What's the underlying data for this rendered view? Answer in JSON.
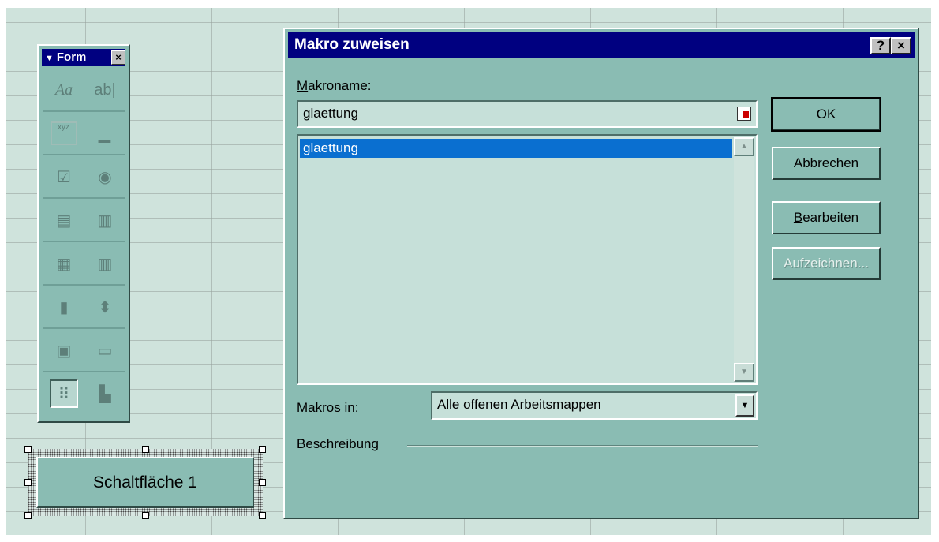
{
  "toolbar": {
    "title": "Form",
    "close": "×",
    "rows": [
      {
        "left_icon": "label-icon",
        "left_glyph": "Aa",
        "right_icon": "edit-box-icon",
        "right_glyph": "ab|"
      },
      {
        "left_icon": "group-box-icon",
        "left_glyph": "xyz",
        "right_icon": "button-icon",
        "right_glyph": "▁"
      },
      {
        "left_icon": "checkbox-icon",
        "left_glyph": "☑",
        "right_icon": "option-button-icon",
        "right_glyph": "◉"
      },
      {
        "left_icon": "list-box-icon",
        "left_glyph": "▤",
        "right_icon": "combo-box-icon",
        "right_glyph": "▥"
      },
      {
        "left_icon": "combo-list-edit-icon",
        "left_glyph": "▦",
        "right_icon": "combo-dropdown-edit-icon",
        "right_glyph": "▥"
      },
      {
        "left_icon": "scroll-bar-icon",
        "left_glyph": "▮",
        "right_icon": "spinner-icon",
        "right_glyph": "⬍"
      },
      {
        "left_icon": "control-properties-icon",
        "left_glyph": "▣",
        "right_icon": "edit-code-icon",
        "right_glyph": "▭"
      },
      {
        "left_icon": "toggle-grid-icon",
        "left_glyph": "⠿",
        "right_icon": "run-dialog-icon",
        "right_glyph": "▙"
      }
    ]
  },
  "sheet_button": {
    "label": "Schaltfläche 1"
  },
  "dialog": {
    "title": "Makro zuweisen",
    "help": "?",
    "close": "×",
    "macro_name_label_u": "M",
    "macro_name_label_rest": "akroname:",
    "macro_name_value": "glaettung",
    "list_items": [
      "glaettung"
    ],
    "macros_in_label_a": "Ma",
    "macros_in_label_u": "k",
    "macros_in_label_b": "ros in:",
    "macros_in_value": "Alle offenen Arbeitsmappen",
    "description_label": "Beschreibung",
    "buttons": {
      "ok": "OK",
      "cancel": "Abbrechen",
      "edit_u": "B",
      "edit_rest": "earbeiten",
      "record": "Aufzeichnen..."
    }
  }
}
